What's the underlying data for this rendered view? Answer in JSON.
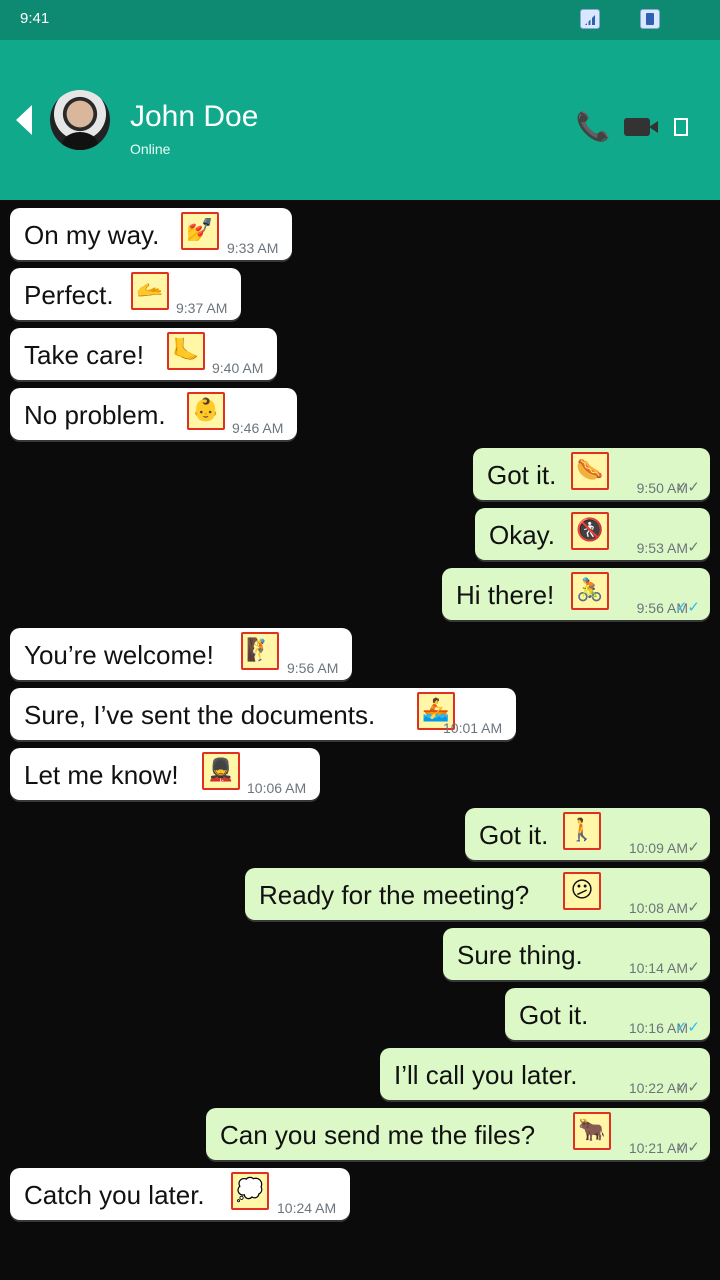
{
  "status_bar": {
    "time": "9:41"
  },
  "header": {
    "contact_name": "John Doe",
    "contact_status": "Online",
    "phone_icon": "📞"
  },
  "messages": [
    {
      "dir": "in",
      "text": "On my way.",
      "emoji": "💅",
      "time": "9:33 AM"
    },
    {
      "dir": "in",
      "text": "Perfect.",
      "emoji": "🫴",
      "time": "9:37 AM"
    },
    {
      "dir": "in",
      "text": "Take care!",
      "emoji": "🦶",
      "time": "9:40 AM"
    },
    {
      "dir": "in",
      "text": "No problem.",
      "emoji": "👶",
      "time": "9:46 AM"
    },
    {
      "dir": "out",
      "text": "Got it.",
      "emoji": "🌭",
      "time": "9:50 AM",
      "ticks": "✓✓",
      "read": false
    },
    {
      "dir": "out",
      "text": "Okay.",
      "emoji": "🚷",
      "time": "9:53 AM",
      "ticks": "✓",
      "read": false
    },
    {
      "dir": "out",
      "text": "Hi there!",
      "emoji": "🚴",
      "time": "9:56 AM",
      "ticks": "✓✓",
      "read": true
    },
    {
      "dir": "in",
      "text": "You’re welcome!",
      "emoji": "🧗",
      "time": "9:56 AM"
    },
    {
      "dir": "in",
      "text": "Sure, I’ve sent the documents.",
      "emoji": "🚣",
      "time": "10:01 AM"
    },
    {
      "dir": "in",
      "text": "Let me know!",
      "emoji": "💂",
      "time": "10:06 AM"
    },
    {
      "dir": "out",
      "text": "Got it.",
      "emoji": "🚶",
      "time": "10:09 AM",
      "ticks": "✓",
      "read": false
    },
    {
      "dir": "out",
      "text": "Ready for the meeting?",
      "emoji": "😕",
      "time": "10:08 AM",
      "ticks": "✓",
      "read": false
    },
    {
      "dir": "out",
      "text": "Sure thing.",
      "emoji": "",
      "time": "10:14 AM",
      "ticks": "✓",
      "read": false
    },
    {
      "dir": "out",
      "text": "Got it.",
      "emoji": "",
      "time": "10:16 AM",
      "ticks": "✓✓",
      "read": true
    },
    {
      "dir": "out",
      "text": "I’ll call you later.",
      "emoji": "",
      "time": "10:22 AM",
      "ticks": "✓✓",
      "read": false
    },
    {
      "dir": "out",
      "text": "Can you send me the files?",
      "emoji": "🐂",
      "time": "10:21 AM",
      "ticks": "✓✓",
      "read": false
    },
    {
      "dir": "in",
      "text": "Catch you later.",
      "emoji": "💭",
      "time": "10:24 AM"
    }
  ]
}
